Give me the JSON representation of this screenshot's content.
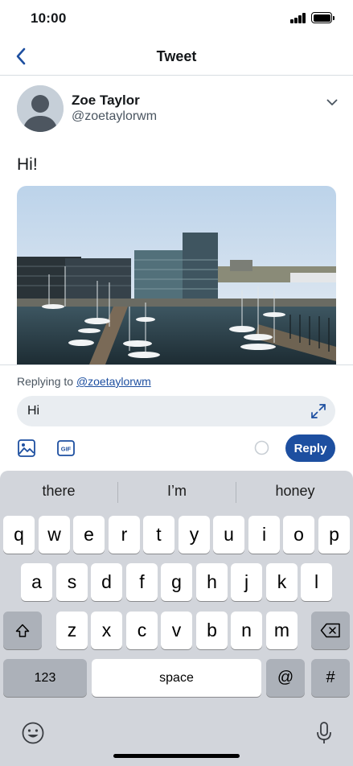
{
  "status_bar": {
    "time": "10:00"
  },
  "nav": {
    "title": "Tweet"
  },
  "tweet": {
    "author_name": "Zoe Taylor",
    "author_handle": "@zoetaylorwm",
    "text": "Hi!"
  },
  "composer": {
    "replying_prefix": "Replying to ",
    "replying_handle": "@zoetaylorwm",
    "input_value": "Hi",
    "reply_label": "Reply",
    "gif_label": "GIF"
  },
  "keyboard": {
    "suggestions": [
      "there",
      "I’m",
      "honey"
    ],
    "row1": [
      "q",
      "w",
      "e",
      "r",
      "t",
      "y",
      "u",
      "i",
      "o",
      "p"
    ],
    "row2": [
      "a",
      "s",
      "d",
      "f",
      "g",
      "h",
      "j",
      "k",
      "l"
    ],
    "row3": [
      "z",
      "x",
      "c",
      "v",
      "b",
      "n",
      "m"
    ],
    "numbers_label": "123",
    "space_label": "space",
    "at_label": "@",
    "hash_label": "#"
  },
  "icons": {
    "back": "chevron-left-icon",
    "more": "chevron-down-icon",
    "expand": "expand-arrows-icon",
    "media": "image-icon",
    "gif": "gif-icon",
    "shift": "shift-icon",
    "backspace": "backspace-icon",
    "emoji": "emoji-icon",
    "mic": "microphone-icon"
  },
  "colors": {
    "accent": "#1d4fa0",
    "keyboard_bg": "#d2d5db",
    "special_key": "#acb1b9"
  }
}
